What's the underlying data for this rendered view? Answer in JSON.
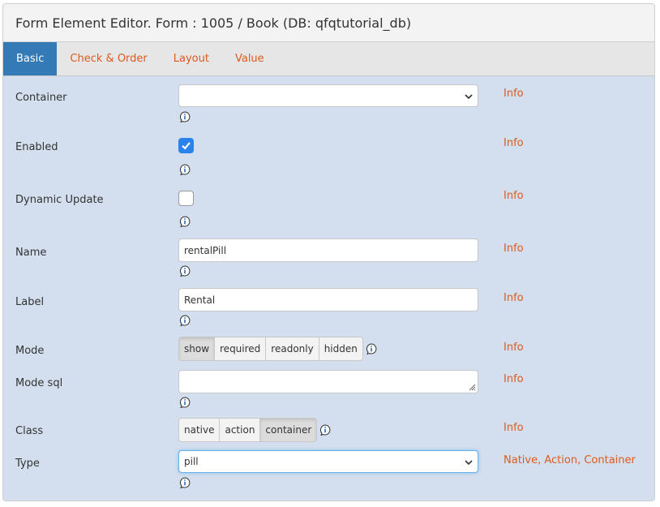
{
  "header": {
    "title": "Form Element Editor. Form : 1005 / Book (DB: qfqtutorial_db)"
  },
  "tabs": [
    {
      "label": "Basic"
    },
    {
      "label": "Check & Order"
    },
    {
      "label": "Layout"
    },
    {
      "label": "Value"
    }
  ],
  "fields": {
    "container": {
      "label": "Container",
      "value": "",
      "info": "Info"
    },
    "enabled": {
      "label": "Enabled",
      "checked": true,
      "info": "Info"
    },
    "dynamic_update": {
      "label": "Dynamic Update",
      "checked": false,
      "info": "Info"
    },
    "name": {
      "label": "Name",
      "value": "rentalPill",
      "info": "Info"
    },
    "label": {
      "label": "Label",
      "value": "Rental",
      "info": "Info"
    },
    "mode": {
      "label": "Mode",
      "options": [
        "show",
        "required",
        "readonly",
        "hidden"
      ],
      "selected": "show",
      "info": "Info"
    },
    "mode_sql": {
      "label": "Mode sql",
      "value": "",
      "info": "Info"
    },
    "class": {
      "label": "Class",
      "options": [
        "native",
        "action",
        "container"
      ],
      "selected": "container",
      "info": "Info"
    },
    "type": {
      "label": "Type",
      "value": "pill",
      "info_links": [
        "Native",
        "Action",
        "Container"
      ]
    }
  },
  "colors": {
    "accent_orange": "#dd5a1d",
    "tab_active": "#337ab7",
    "checkbox_on": "#2a82ea",
    "form_bg": "#d3dfee"
  },
  "icons": {
    "help": "info-bubble-icon",
    "select_arrow": "chevron-down-icon",
    "check": "checkmark-icon"
  }
}
